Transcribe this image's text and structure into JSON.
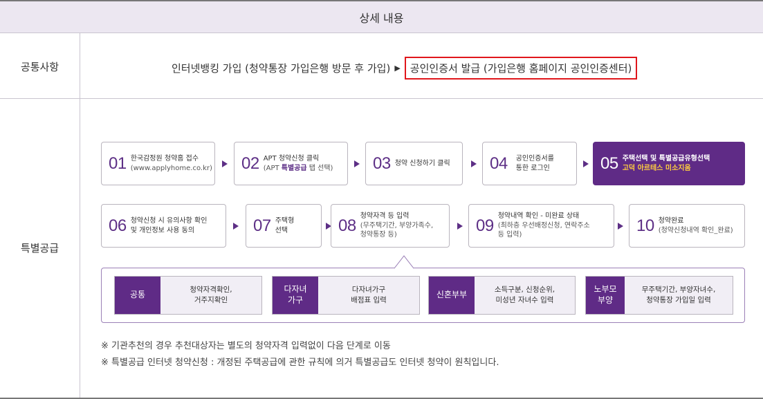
{
  "header": {
    "title": "상세 내용"
  },
  "rows": {
    "common": {
      "label": "공통사항",
      "text_before": "인터넷뱅킹 가입 (청약통장 가입은행 방문 후 가입)",
      "arrow": "▶",
      "highlighted": "공인인증서 발급 (가입은행 홈페이지 공인인증센터)"
    },
    "special": {
      "label": "특별공급"
    }
  },
  "steps": [
    {
      "num": "01",
      "line1": "한국감정원 청약홈 접수",
      "line2": "(www.applyhome.co.kr)"
    },
    {
      "num": "02",
      "line1": "APT 청약신청 클릭",
      "line2_pre": "(APT ",
      "line2_hi": "특별공급",
      "line2_post": " 탭 선택)"
    },
    {
      "num": "03",
      "line1": "청약 신청하기 클릭"
    },
    {
      "num": "04",
      "line1": "공인인증서를",
      "line2": "통한 로그인"
    },
    {
      "num": "05",
      "line1": "주택선택 및 특별공급유형선택",
      "line2": "고덕 아르테스 미소지움"
    },
    {
      "num": "06",
      "line1": "청약신청 시 유의사항 확인",
      "line2": "및 개인정보 사용 동의"
    },
    {
      "num": "07",
      "line1": "주택형",
      "line2": "선택"
    },
    {
      "num": "08",
      "line1": "청약자격 등 입력",
      "line2": "(무주택기간, 부양가족수,",
      "line3": "청약통장 등)"
    },
    {
      "num": "09",
      "line1": "청약내역 확인 - 미완료 상태",
      "line2": "(최하층 우선배정신청, 연락주소",
      "line3": "등 입력)"
    },
    {
      "num": "10",
      "line1": "청약완료",
      "line2": "(청약신청내역 확인_완료)"
    }
  ],
  "details": [
    {
      "tag": "공통",
      "desc1": "청약자격확인,",
      "desc2": "거주지확인"
    },
    {
      "tag1": "다자녀",
      "tag2": "가구",
      "desc1": "다자녀가구",
      "desc2": "배점표 입력"
    },
    {
      "tag": "신혼부부",
      "desc1": "소득구분, 신청순위,",
      "desc2": "미성년 자녀수 입력"
    },
    {
      "tag1": "노부모",
      "tag2": "부양",
      "desc1": "무주택기간, 부양자녀수,",
      "desc2": "청약통장 가입일 입력"
    }
  ],
  "notes": [
    "※ 기관추천의 경우 추천대상자는 별도의 청약자격 입력없이 다음 단계로 이동",
    "※ 특별공급 인터넷 청약신청 : 개정된 주택공급에 관한 규칙에 의거 특별공급도 인터넷 청약이 원칙입니다."
  ],
  "colors": {
    "accent": "#5f2b86",
    "highlight_border": "#e0161b",
    "gold": "#ffcf3f",
    "header_bg": "#ece7f1"
  }
}
